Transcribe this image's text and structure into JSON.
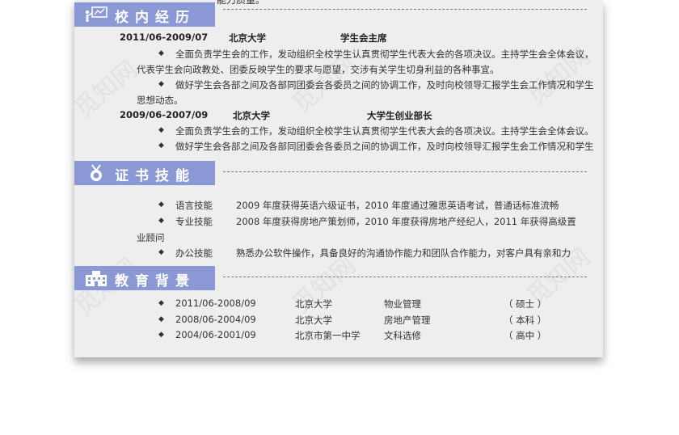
{
  "watermark": "觅知网",
  "cutoff_text": "能力质量。",
  "sections": {
    "campus": {
      "title": "校内经历",
      "entries": [
        {
          "period": "2011/06-2009/07",
          "org": "北京大学",
          "role": "学生会主席",
          "bullets": [
            {
              "lines": [
                "全面负责学生会的工作，发动组织全校学生认真贯彻学生代表大会的各项决议。主持学生会全体会议，",
                "代表学生会向政教处、团委反映学生的要求与愿望，交涉有关学生切身利益的各种事宜。"
              ]
            },
            {
              "lines": [
                "做好学生会各部之间及各部同团委会各委员之间的协调工作，及时向校领导汇报学生会工作情况和学生",
                "思想动态。"
              ]
            }
          ]
        },
        {
          "period": "2009/06-2007/09",
          "org": "北京大学",
          "role": "大学生创业部长",
          "bullets": [
            {
              "lines": [
                "全面负责学生会的工作，发动组织全校学生认真贯彻学生代表大会的各项决议。主持学生会全体会议。"
              ]
            },
            {
              "lines": [
                "做好学生会各部之间及各部同团委会各委员之间的协调工作，及时向校领导汇报学生会工作情况和学生"
              ]
            }
          ]
        }
      ]
    },
    "skills": {
      "title": "证书技能",
      "items": [
        {
          "label": "语言技能",
          "lines": [
            "2009 年度获得英语六级证书，2010 年度通过雅思英语考试，普通话标准流畅"
          ]
        },
        {
          "label": "专业技能",
          "lines": [
            "2008 年度获得房地产策划师，2010 年度获得房地产经纪人，2011 年获得高级置",
            "业顾问"
          ]
        },
        {
          "label": "办公技能",
          "lines": [
            "熟悉办公软件操作，具备良好的沟通协作能力和团队合作能力，对客户具有亲和力"
          ]
        }
      ]
    },
    "education": {
      "title": "教育背景",
      "rows": [
        {
          "period": "2011/06-2008/09",
          "school": "北京大学",
          "major": "物业管理",
          "degree": "（ 硕士 ）"
        },
        {
          "period": "2008/06-2004/09",
          "school": "北京大学",
          "major": "房地产管理",
          "degree": "（ 本科 ）"
        },
        {
          "period": "2004/06-2001/09",
          "school": "北京市第一中学",
          "major": "文科选修",
          "degree": "（ 高中 ）"
        }
      ]
    }
  },
  "icons": {
    "campus": "graduation-teacher-icon",
    "skills": "medal-icon",
    "education": "building-icon"
  },
  "colors": {
    "header_bg": "#8a98d6",
    "page_bg": "#eeeeef",
    "text": "#333333"
  }
}
